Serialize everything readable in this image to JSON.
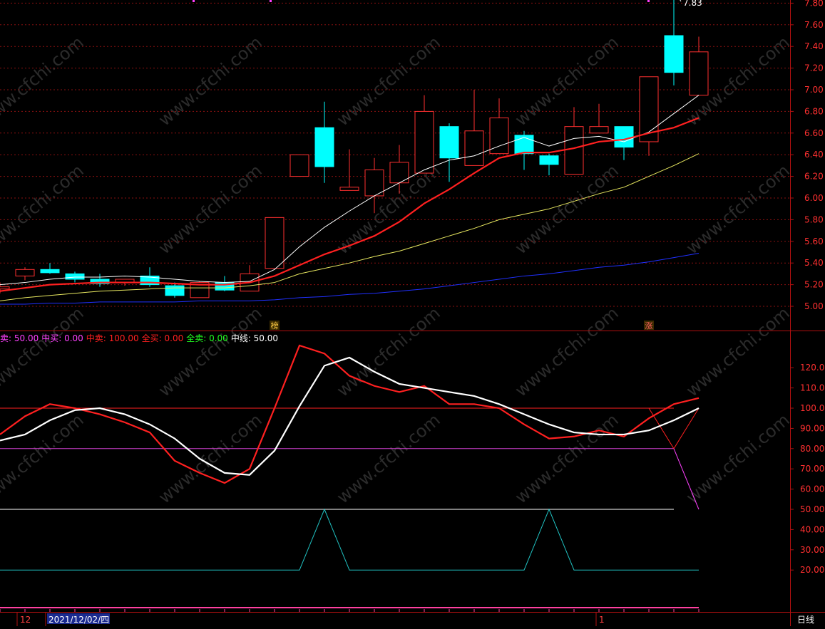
{
  "chart_data": [
    {
      "type": "candlestick",
      "ylim": [
        4.8,
        7.85
      ],
      "y_ticks": [
        "7.80",
        "7.60",
        "7.40",
        "7.20",
        "7.00",
        "6.80",
        "6.60",
        "6.40",
        "6.20",
        "6.00",
        "5.80",
        "5.60",
        "5.40",
        "5.20",
        "5.00"
      ],
      "y_tick_values": [
        7.8,
        7.6,
        7.4,
        7.2,
        7.0,
        6.8,
        6.6,
        6.4,
        6.2,
        6.0,
        5.8,
        5.6,
        5.4,
        5.2,
        5.0
      ],
      "grid": true,
      "candles": [
        {
          "o": 5.16,
          "h": 5.22,
          "l": 5.12,
          "c": 5.18
        },
        {
          "o": 5.28,
          "h": 5.36,
          "l": 5.24,
          "c": 5.34
        },
        {
          "o": 5.34,
          "h": 5.4,
          "l": 5.3,
          "c": 5.31
        },
        {
          "o": 5.3,
          "h": 5.32,
          "l": 5.22,
          "c": 5.25
        },
        {
          "o": 5.25,
          "h": 5.3,
          "l": 5.18,
          "c": 5.21
        },
        {
          "o": 5.22,
          "h": 5.25,
          "l": 5.19,
          "c": 5.25
        },
        {
          "o": 5.28,
          "h": 5.36,
          "l": 5.18,
          "c": 5.2
        },
        {
          "o": 5.19,
          "h": 5.22,
          "l": 5.08,
          "c": 5.1
        },
        {
          "o": 5.08,
          "h": 5.23,
          "l": 5.08,
          "c": 5.22
        },
        {
          "o": 5.22,
          "h": 5.28,
          "l": 5.14,
          "c": 5.15
        },
        {
          "o": 5.14,
          "h": 5.38,
          "l": 5.14,
          "c": 5.3
        },
        {
          "o": 5.35,
          "h": 5.82,
          "l": 5.35,
          "c": 5.82
        },
        {
          "o": 6.2,
          "h": 6.4,
          "l": 6.2,
          "c": 6.4
        },
        {
          "o": 6.65,
          "h": 6.89,
          "l": 6.14,
          "c": 6.29
        },
        {
          "o": 6.07,
          "h": 6.45,
          "l": 6.07,
          "c": 6.1
        },
        {
          "o": 6.02,
          "h": 6.37,
          "l": 5.86,
          "c": 6.26
        },
        {
          "o": 6.14,
          "h": 6.49,
          "l": 6.04,
          "c": 6.33
        },
        {
          "o": 6.23,
          "h": 6.95,
          "l": 6.23,
          "c": 6.8
        },
        {
          "o": 6.66,
          "h": 6.69,
          "l": 6.15,
          "c": 6.37
        },
        {
          "o": 6.3,
          "h": 7.0,
          "l": 6.3,
          "c": 6.62
        },
        {
          "o": 6.41,
          "h": 6.92,
          "l": 6.41,
          "c": 6.74
        },
        {
          "o": 6.58,
          "h": 6.62,
          "l": 6.26,
          "c": 6.41
        },
        {
          "o": 6.39,
          "h": 6.41,
          "l": 6.21,
          "c": 6.31
        },
        {
          "o": 6.22,
          "h": 6.84,
          "l": 6.22,
          "c": 6.66
        },
        {
          "o": 6.6,
          "h": 6.87,
          "l": 6.6,
          "c": 6.66
        },
        {
          "o": 6.66,
          "h": 6.66,
          "l": 6.35,
          "c": 6.47
        },
        {
          "o": 6.52,
          "h": 7.12,
          "l": 6.39,
          "c": 7.12
        },
        {
          "o": 7.5,
          "h": 7.83,
          "l": 7.04,
          "c": 7.16
        },
        {
          "o": 6.95,
          "h": 7.49,
          "l": 6.95,
          "c": 7.35
        }
      ],
      "ma_series": [
        {
          "color": "#ffffff",
          "values": [
            5.2,
            5.22,
            5.25,
            5.27,
            5.27,
            5.28,
            5.27,
            5.25,
            5.23,
            5.22,
            5.23,
            5.34,
            5.55,
            5.73,
            5.88,
            6.02,
            6.14,
            6.26,
            6.35,
            6.39,
            6.48,
            6.56,
            6.48,
            6.55,
            6.57,
            6.52,
            6.61,
            6.78,
            6.95
          ]
        },
        {
          "color": "#ff2020",
          "values": [
            5.14,
            5.17,
            5.2,
            5.21,
            5.22,
            5.22,
            5.22,
            5.21,
            5.2,
            5.2,
            5.22,
            5.28,
            5.38,
            5.48,
            5.56,
            5.65,
            5.78,
            5.95,
            6.08,
            6.23,
            6.37,
            6.42,
            6.42,
            6.46,
            6.52,
            6.54,
            6.6,
            6.65,
            6.74
          ]
        },
        {
          "color": "#e8e860",
          "values": [
            5.05,
            5.08,
            5.1,
            5.12,
            5.14,
            5.15,
            5.16,
            5.17,
            5.17,
            5.17,
            5.19,
            5.22,
            5.3,
            5.35,
            5.4,
            5.46,
            5.51,
            5.58,
            5.65,
            5.72,
            5.8,
            5.85,
            5.9,
            5.97,
            6.04,
            6.1,
            6.2,
            6.3,
            6.41
          ]
        },
        {
          "color": "#2030ff",
          "values": [
            5.02,
            5.02,
            5.03,
            5.03,
            5.04,
            5.04,
            5.04,
            5.04,
            5.05,
            5.05,
            5.05,
            5.06,
            5.08,
            5.09,
            5.11,
            5.12,
            5.14,
            5.16,
            5.19,
            5.22,
            5.25,
            5.28,
            5.3,
            5.33,
            5.36,
            5.38,
            5.41,
            5.45,
            5.49
          ]
        }
      ],
      "annotations": [
        {
          "index": 27,
          "text": "7.83",
          "value": 7.83
        },
        {
          "index": 11,
          "text": "榜",
          "value": 4.97
        },
        {
          "index": 26,
          "text": "涨",
          "value": 4.97
        }
      ]
    },
    {
      "type": "line",
      "ylim": [
        0,
        130
      ],
      "y_ticks": [
        "120.0",
        "110.0",
        "100.0",
        "90.00",
        "80.00",
        "70.00",
        "60.00",
        "50.00",
        "40.00",
        "30.00",
        "20.00"
      ],
      "y_tick_values": [
        120,
        110,
        100,
        90,
        80,
        70,
        60,
        50,
        40,
        30,
        20
      ],
      "legend": [
        {
          "text": "卖: 50.00",
          "color": "#ff40ff"
        },
        {
          "text": "中买: 0.00",
          "color": "#ff40ff"
        },
        {
          "text": "中卖: 100.00",
          "color": "#ff2020"
        },
        {
          "text": "全买: 0.00",
          "color": "#ff2020"
        },
        {
          "text": "全卖: 0.00",
          "color": "#20ff20"
        },
        {
          "text": "中线: 50.00",
          "color": "#ffffff"
        }
      ],
      "series": [
        {
          "color": "#ff2020",
          "values": [
            87,
            96,
            102,
            100,
            97,
            93,
            88,
            74,
            68,
            63,
            70,
            100,
            131,
            127,
            116,
            111,
            108,
            111,
            102,
            102,
            100,
            92,
            85,
            86,
            89,
            86,
            95,
            102,
            105
          ]
        },
        {
          "color": "#ffffff",
          "values": [
            84,
            87,
            94,
            99,
            100,
            97,
            92,
            85,
            75,
            68,
            67,
            79,
            101,
            121,
            125,
            118,
            112,
            110,
            108,
            106,
            102,
            97,
            92,
            88,
            87,
            87,
            89,
            94,
            100
          ]
        },
        {
          "color": "#20c0c0",
          "values": [
            20,
            20,
            20,
            20,
            20,
            20,
            20,
            20,
            20,
            20,
            20,
            20,
            20,
            50,
            20,
            20,
            20,
            20,
            20,
            20,
            20,
            20,
            50,
            20,
            20,
            20,
            20,
            20,
            20
          ]
        }
      ],
      "hlines": [
        {
          "value": 100,
          "color": "#ff2020"
        },
        {
          "value": 80,
          "color": "#d040d0"
        },
        {
          "value": 50,
          "color": "#ffffff"
        }
      ],
      "extras": [
        {
          "color": "#ff2020",
          "points": [
            [
              26,
              100
            ],
            [
              27,
              80
            ],
            [
              28,
              100
            ]
          ]
        },
        {
          "color": "#ff40ff",
          "points": [
            [
              27,
              80
            ],
            [
              28,
              50
            ]
          ]
        }
      ]
    }
  ],
  "xaxis": {
    "labels": [
      {
        "text": "12",
        "color": "#ff4040",
        "index": 0
      },
      {
        "text": "2021/12/02/四",
        "color": "#ffffff",
        "index": 1
      },
      {
        "text": "1",
        "color": "#ff4040",
        "index": 23
      }
    ],
    "period": "日线"
  },
  "watermark": "www.cfchi.com",
  "colors": {
    "up": "#ff3030",
    "down": "#00ffff",
    "grid": "#8a1010",
    "axis": "#b01010",
    "text": "#ff3030"
  }
}
